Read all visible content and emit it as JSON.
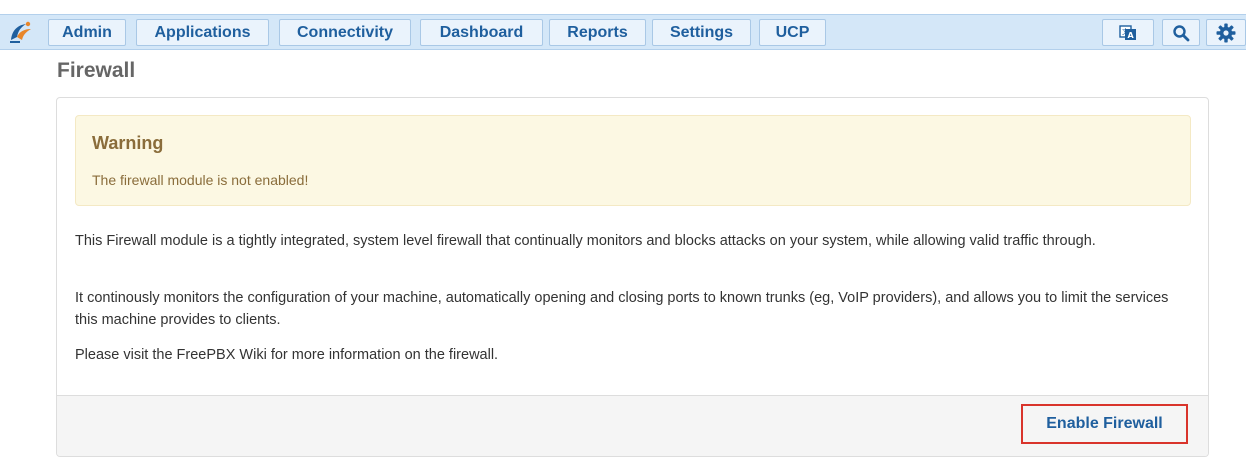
{
  "nav": {
    "items": [
      {
        "label": "Admin"
      },
      {
        "label": "Applications"
      },
      {
        "label": "Connectivity"
      },
      {
        "label": "Dashboard"
      },
      {
        "label": "Reports"
      },
      {
        "label": "Settings"
      },
      {
        "label": "UCP"
      }
    ],
    "icons": [
      "translate-icon",
      "search-icon",
      "gear-icon"
    ],
    "accent_color": "#1f5f9e",
    "bar_color": "#d4e7f8"
  },
  "page": {
    "title": "Firewall"
  },
  "alert": {
    "title": "Warning",
    "message": "The firewall module is not enabled!",
    "color": "#fcf8e3"
  },
  "content": {
    "paragraphs": [
      "This Firewall module is a tightly integrated, system level firewall that continually monitors and blocks attacks on your system, while allowing valid traffic through.",
      "It continously monitors the configuration of your machine, automatically opening and closing ports to known trunks (eg, VoIP providers), and allows you to limit the services this machine provides to clients.",
      "Please visit the FreePBX Wiki for more information on the firewall."
    ]
  },
  "footer": {
    "enable_button_label": "Enable Firewall"
  }
}
